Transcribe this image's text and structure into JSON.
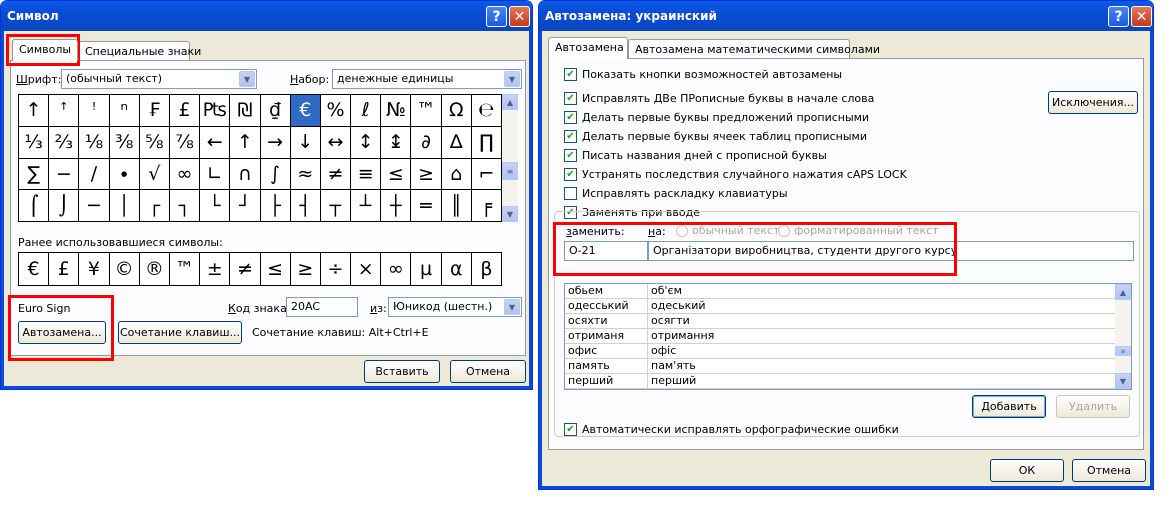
{
  "symbol_dialog": {
    "title": "Символ",
    "tabs": [
      "Символы",
      "Специальные знаки"
    ],
    "font_label": "Шрифт:",
    "font_value": "(обычный текст)",
    "subset_label": "Набор:",
    "subset_value": "денежные единицы",
    "grid_rows": [
      [
        "↑",
        "ꜛ",
        "ꜝ",
        "ⁿ",
        "₣",
        "£",
        "₧",
        "₪",
        "₫",
        "€",
        "%",
        "ℓ",
        "№",
        "™",
        "Ω",
        "℮"
      ],
      [
        "⅓",
        "⅔",
        "⅛",
        "⅜",
        "⅝",
        "⅞",
        "←",
        "↑",
        "→",
        "↓",
        "↔",
        "↕",
        "↨",
        "∂",
        "∆",
        "∏"
      ],
      [
        "∑",
        "−",
        "∕",
        "∙",
        "√",
        "∞",
        "∟",
        "∩",
        "∫",
        "≈",
        "≠",
        "≡",
        "≤",
        "≥",
        "⌂",
        "⌐"
      ],
      [
        "⌠",
        "⌡",
        "─",
        "│",
        "┌",
        "┐",
        "└",
        "┘",
        "├",
        "┤",
        "┬",
        "┴",
        "┼",
        "═",
        "║",
        "╒"
      ]
    ],
    "selected": "€",
    "recent_label": "Ранее использовавшиеся символы:",
    "recent": [
      "€",
      "£",
      "¥",
      "©",
      "®",
      "™",
      "±",
      "≠",
      "≤",
      "≥",
      "÷",
      "×",
      "∞",
      "µ",
      "α",
      "β"
    ],
    "char_name": "Euro Sign",
    "code_label": "Код знака:",
    "code_value": "20AC",
    "from_label": "из:",
    "from_value": "Юникод (шестн.)",
    "autocorrect_btn": "Автозамена...",
    "shortcut_btn": "Сочетание клавиш...",
    "shortcut_text": "Сочетание клавиш: Alt+Ctrl+E",
    "insert_btn": "Вставить",
    "cancel_btn": "Отмена"
  },
  "autocorrect_dialog": {
    "title": "Автозамена: украинский",
    "tabs": [
      "Автозамена",
      "Автозамена математическими символами"
    ],
    "options": [
      {
        "label": "Показать кнопки возможностей автозамены",
        "checked": true
      },
      {
        "label": "Исправлять ДВе ПРописные буквы в начале слова",
        "checked": true
      },
      {
        "label": "Делать первые буквы предложений прописными",
        "checked": true
      },
      {
        "label": "Делать первые буквы ячеек таблиц прописными",
        "checked": true
      },
      {
        "label": "Писать названия дней с прописной буквы",
        "checked": true
      },
      {
        "label": "Устранять последствия случайного нажатия cAPS LOCK",
        "checked": true
      },
      {
        "label": "Исправлять раскладку клавиатуры",
        "checked": false
      },
      {
        "label": "Заменять при вводе",
        "checked": true
      }
    ],
    "exceptions_btn": "Исключения...",
    "replace_label": "заменить:",
    "with_label": "на:",
    "radio_plain": "обычный текст",
    "radio_formatted": "форматированный текст",
    "replace_value": "О-21",
    "with_value": "Організатори виробництва, студенти другого курсу",
    "entries": [
      [
        "обьем",
        "об'єм"
      ],
      [
        "одесський",
        "одеський"
      ],
      [
        "осяхти",
        "осягти"
      ],
      [
        "отриманя",
        "отримання"
      ],
      [
        "офис",
        "офіс"
      ],
      [
        "память",
        "пам'ять"
      ],
      [
        "перший",
        "перший"
      ]
    ],
    "add_btn": "Добавить",
    "delete_btn": "Удалить",
    "auto_spell": "Автоматически исправлять орфографические ошибки",
    "ok_btn": "ОК",
    "cancel_btn": "Отмена"
  }
}
